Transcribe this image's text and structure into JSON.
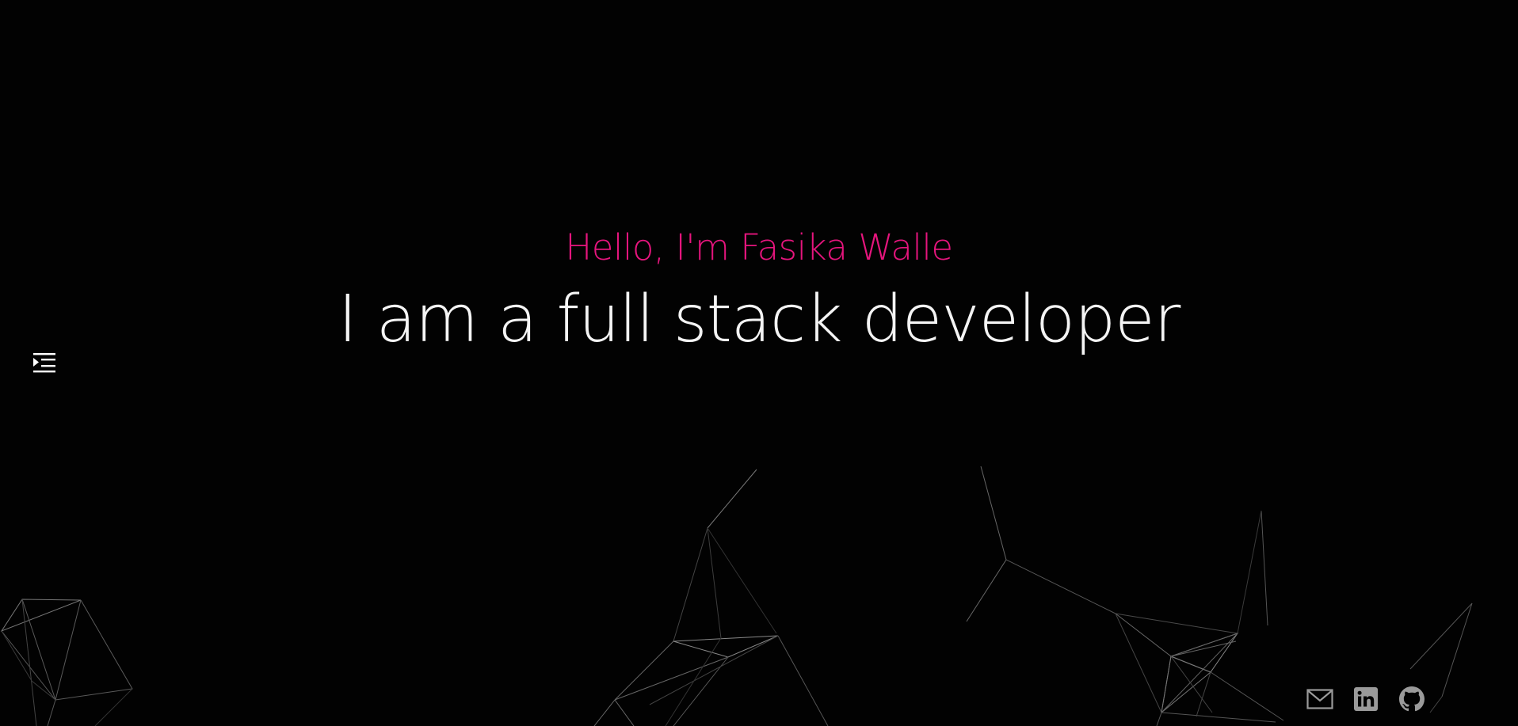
{
  "hero": {
    "greeting": "Hello, I'm Fasika Walle",
    "tagline": "I am a full stack developer"
  },
  "menu": {
    "icon": "menu-indent-icon"
  },
  "social": [
    {
      "name": "email",
      "icon": "mail-icon"
    },
    {
      "name": "linkedin",
      "icon": "linkedin-icon"
    },
    {
      "name": "github",
      "icon": "github-icon"
    }
  ],
  "colors": {
    "background": "#020202",
    "accent": "#e5157d",
    "text": "#f4f4f4",
    "icon": "#9a9a9a",
    "network_line": "#5a5a5a"
  }
}
